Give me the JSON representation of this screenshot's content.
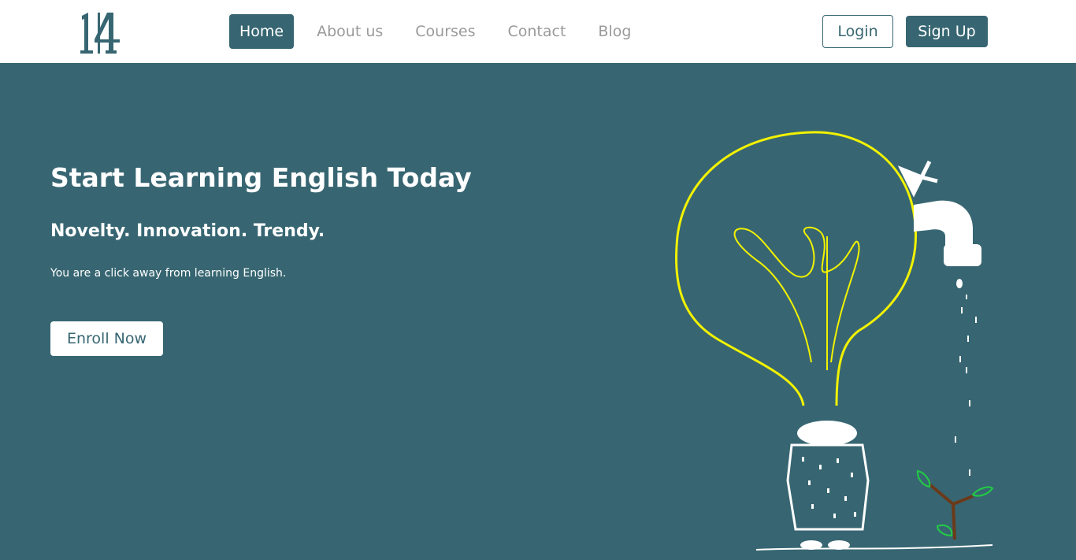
{
  "brand": {
    "logo_text": "14",
    "accent_color": "#376672"
  },
  "nav": {
    "links": [
      {
        "label": "Home",
        "active": true
      },
      {
        "label": "About us",
        "active": false
      },
      {
        "label": "Courses",
        "active": false
      },
      {
        "label": "Contact",
        "active": false
      },
      {
        "label": "Blog",
        "active": false
      }
    ],
    "login_label": "Login",
    "signup_label": "Sign Up"
  },
  "hero": {
    "title": "Start Learning English Today",
    "subtitle": "Novelty. Innovation. Trendy.",
    "text": "You are a click away from learning English.",
    "cta_label": "Enroll Now",
    "background_color": "#376672"
  },
  "illustration": {
    "icon_name": "lightbulb-person-watering-plant-illustration",
    "bulb_color": "#f2f200",
    "leaf_color": "#22cc44"
  }
}
